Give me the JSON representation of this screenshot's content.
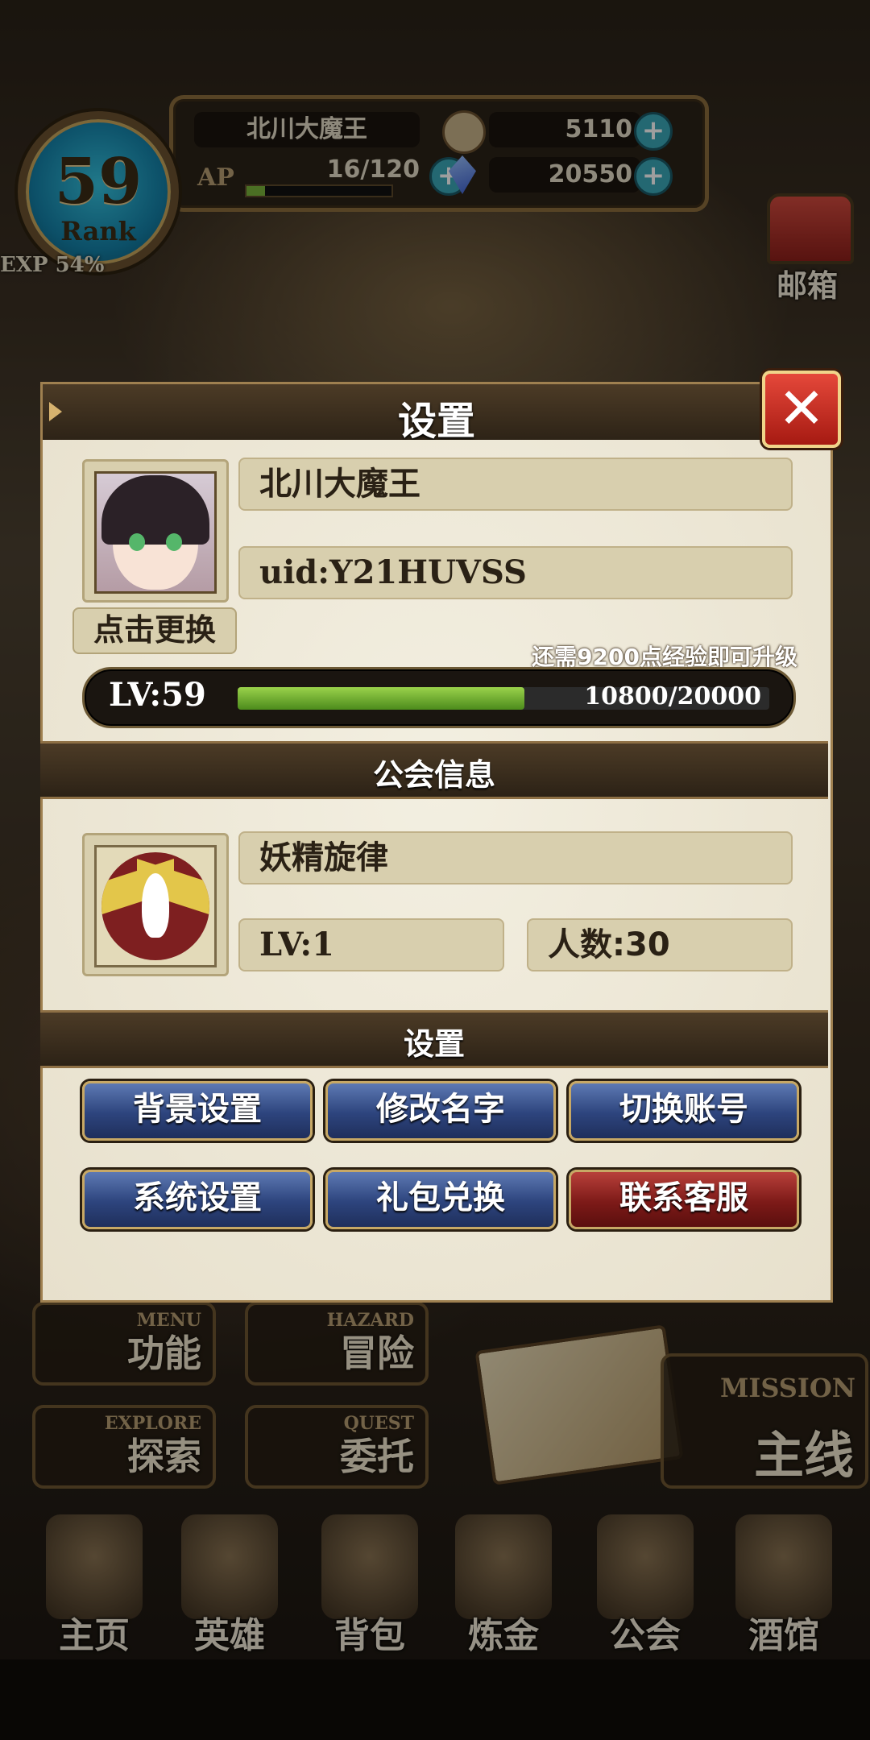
{
  "hud": {
    "rank_number": "59",
    "rank_label": "Rank",
    "exp_text": "EXP 54%",
    "player_name": "北川大魔王",
    "ap_label": "AP",
    "ap_value": "16/120",
    "ap_fraction": 0.13,
    "coins": "5110",
    "gems": "20550",
    "plus": "+",
    "mailbox_label": "邮箱"
  },
  "dialog": {
    "title": "设置",
    "close": "✕",
    "profile": {
      "name": "北川大魔王",
      "uid": "uid:Y21HUVSS",
      "change_avatar": "点击更换",
      "exp_hint": "还需9200点经验即可升级",
      "level": "LV:59",
      "exp_progress": "10800/20000",
      "exp_fraction": 0.54
    },
    "guild": {
      "section_title": "公会信息",
      "name": "妖精旋律",
      "level": "LV:1",
      "members": "人数:30"
    },
    "settings": {
      "section_title": "设置",
      "buttons": [
        "背景设置",
        "修改名字",
        "切换账号",
        "系统设置",
        "礼包兑换",
        "联系客服"
      ]
    }
  },
  "menu": {
    "function": {
      "en": "MENU",
      "cn": "功能"
    },
    "adventure": {
      "en": "HAZARD",
      "cn": "冒险"
    },
    "explore": {
      "en": "EXPLORE",
      "cn": "探索"
    },
    "quest": {
      "en": "QUEST",
      "cn": "委托"
    },
    "mission": {
      "en": "MISSION",
      "cn": "主线"
    }
  },
  "nav": [
    "主页",
    "英雄",
    "背包",
    "炼金",
    "公会",
    "酒馆"
  ],
  "colors": {
    "accent_gold": "#c7a865",
    "button_blue": "#2d447d",
    "button_red": "#7d1a18",
    "exp_green": "#6aa82e"
  }
}
